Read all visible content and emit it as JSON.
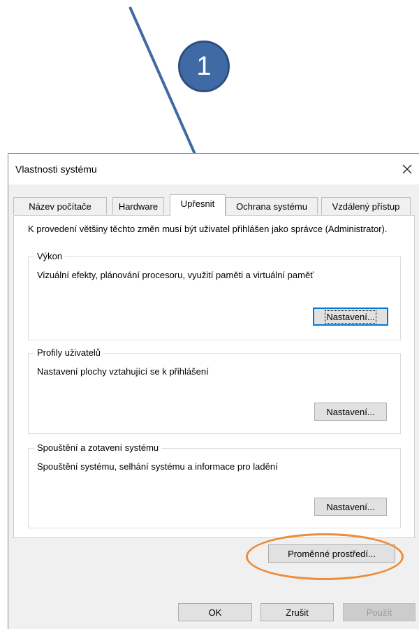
{
  "annotation": {
    "step_number": "1",
    "arrow_color": "#3f6aa6",
    "highlight_color": "#ee8c3a"
  },
  "dialog": {
    "title": "Vlastnosti systému",
    "close_icon": "close-icon",
    "tabs": [
      {
        "label": "Název počítače",
        "active": false
      },
      {
        "label": "Hardware",
        "active": false
      },
      {
        "label": "Upřesnit",
        "active": true
      },
      {
        "label": "Ochrana systému",
        "active": false
      },
      {
        "label": "Vzdálený přístup",
        "active": false
      }
    ],
    "intro_text": "K provedení většiny těchto změn musí být uživatel přihlášen jako správce (Administrator).",
    "groups": [
      {
        "label": "Výkon",
        "description": "Vizuální efekty, plánování procesoru, využití paměti a virtuální paměť",
        "button": "Nastavení..."
      },
      {
        "label": "Profily uživatelů",
        "description": "Nastavení plochy vztahující se k přihlášení",
        "button": "Nastavení..."
      },
      {
        "label": "Spouštění a zotavení systému",
        "description": "Spouštění systému, selhání systému a informace pro ladění",
        "button": "Nastavení..."
      }
    ],
    "env_button": "Proměnné prostředí...",
    "footer": {
      "ok": "OK",
      "cancel": "Zrušit",
      "apply": "Použít"
    }
  }
}
